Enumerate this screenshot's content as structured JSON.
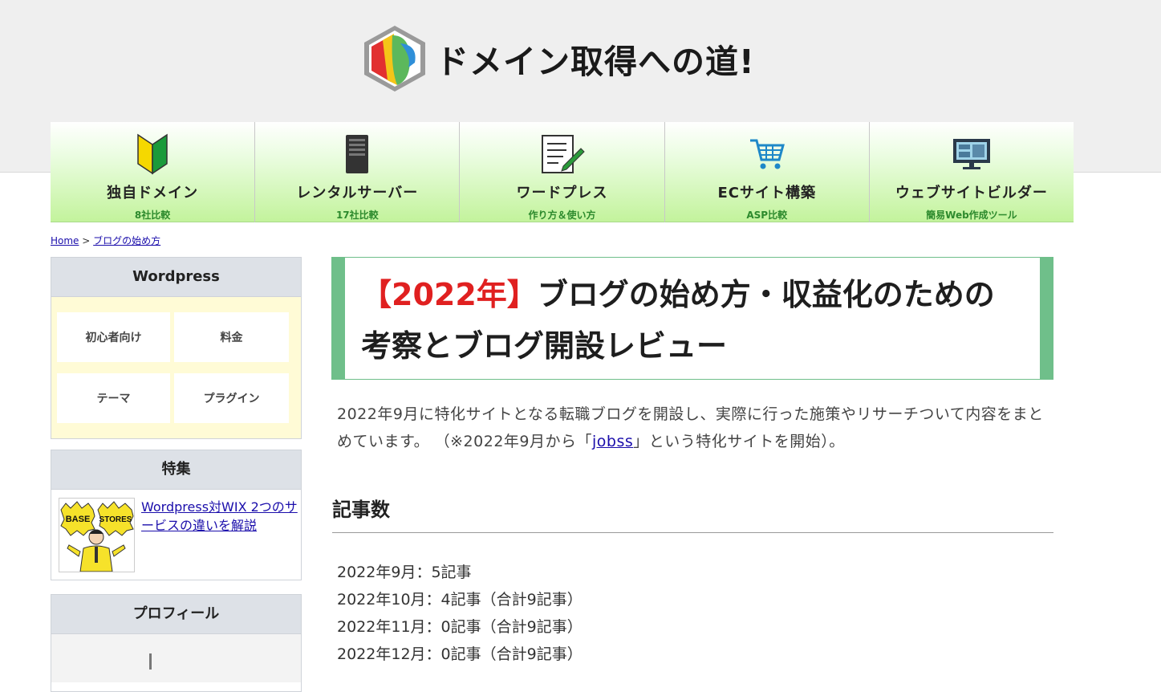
{
  "site": {
    "title": "ドメイン取得への道!"
  },
  "nav": [
    {
      "label": "独自ドメイン",
      "sub": "8社比較",
      "icon": "beginner-mark-icon"
    },
    {
      "label": "レンタルサーバー",
      "sub": "17社比較",
      "icon": "server-icon"
    },
    {
      "label": "ワードプレス",
      "sub": "作り方＆使い方",
      "icon": "document-pencil-icon"
    },
    {
      "label": "ECサイト構築",
      "sub": "ASP比較",
      "icon": "shopping-cart-icon"
    },
    {
      "label": "ウェブサイトビルダー",
      "sub": "簡易Web作成ツール",
      "icon": "monitor-icon"
    }
  ],
  "breadcrumb": {
    "home": "Home",
    "separator": ">",
    "current": "ブログの始め方"
  },
  "sidebar": {
    "wordpress": {
      "title": "Wordpress",
      "items": [
        "初心者向け",
        "料金",
        "テーマ",
        "プラグイン"
      ]
    },
    "featured": {
      "title": "特集",
      "thumb_left": "BASE",
      "thumb_right": "STORES",
      "link": "Wordpress対WIX 2つのサービスの違いを解説"
    },
    "profile": {
      "title": "プロフィール"
    }
  },
  "article": {
    "title_year": "【2022年】",
    "title_rest": "ブログの始め方・収益化のための考察とブログ開設レビュー",
    "intro_before": "2022年9月に特化サイトとなる転職ブログを開設し、実際に行った施策やリサーチついて内容をまとめています。 （※2022年9月から「",
    "intro_link": "jobss",
    "intro_after": "」という特化サイトを開始）。",
    "section_heading": "記事数",
    "counts": [
      "2022年9月：5記事",
      "2022年10月：4記事（合計9記事）",
      "2022年11月：0記事（合計9記事）",
      "2022年12月：0記事（合計9記事）"
    ]
  },
  "colors": {
    "accent_green": "#6fbf8a",
    "title_red": "#e02020",
    "nav_sub_green": "#2d8a2d",
    "link_blue": "#1a0dab"
  }
}
